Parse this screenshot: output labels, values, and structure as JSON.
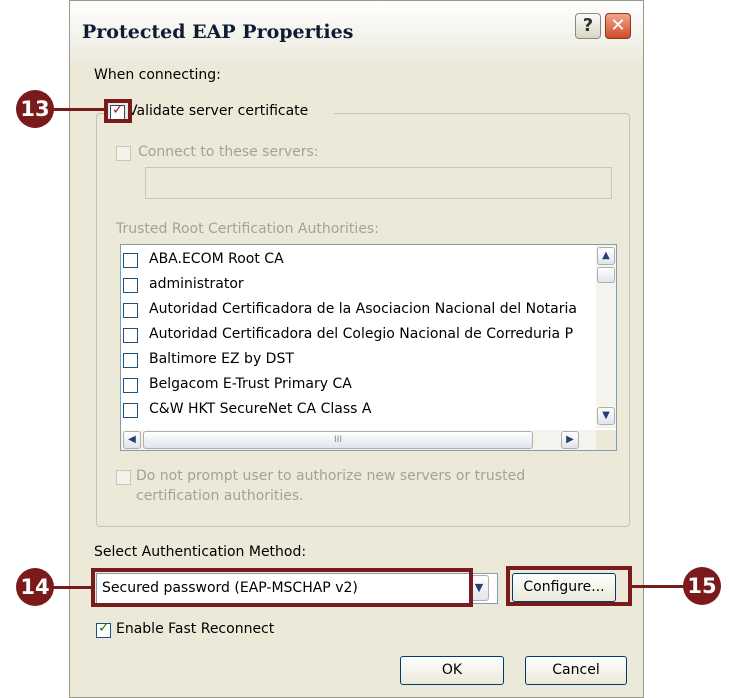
{
  "dialog": {
    "title": "Protected EAP Properties",
    "help_glyph": "?",
    "close_glyph": "✕"
  },
  "connecting": {
    "label": "When connecting:",
    "validate_label": "Validate server certificate",
    "validate_checked": true,
    "connect_label": "Connect to these servers:",
    "connect_value": "",
    "trusted_label": "Trusted Root Certification Authorities:",
    "trusted_items": [
      {
        "label": "ABA.ECOM Root CA",
        "checked": false
      },
      {
        "label": "administrator",
        "checked": false
      },
      {
        "label": "Autoridad Certificadora de la Asociacion Nacional del Notaria",
        "checked": false
      },
      {
        "label": "Autoridad Certificadora del Colegio Nacional de Correduria P",
        "checked": false
      },
      {
        "label": "Baltimore EZ by DST",
        "checked": false
      },
      {
        "label": "Belgacom E-Trust Primary CA",
        "checked": false
      },
      {
        "label": "C&W HKT SecureNet CA Class A",
        "checked": false
      }
    ],
    "hscroll_grip": "III",
    "prompt_line1": "Do not prompt user to authorize new servers or trusted",
    "prompt_line2": "certification authorities."
  },
  "auth": {
    "label": "Select Authentication Method:",
    "method_value": "Secured password (EAP-MSCHAP v2)",
    "configure_label": "Configure...",
    "fast_reconnect_label": "Enable Fast Reconnect",
    "fast_reconnect_checked": true
  },
  "buttons": {
    "ok": "OK",
    "cancel": "Cancel"
  },
  "callouts": {
    "c13": "13",
    "c14": "14",
    "c15": "15"
  },
  "colors": {
    "callout": "#7a1a1a",
    "dialog_bg": "#ece9d8",
    "check_green": "#1e7a1e"
  }
}
